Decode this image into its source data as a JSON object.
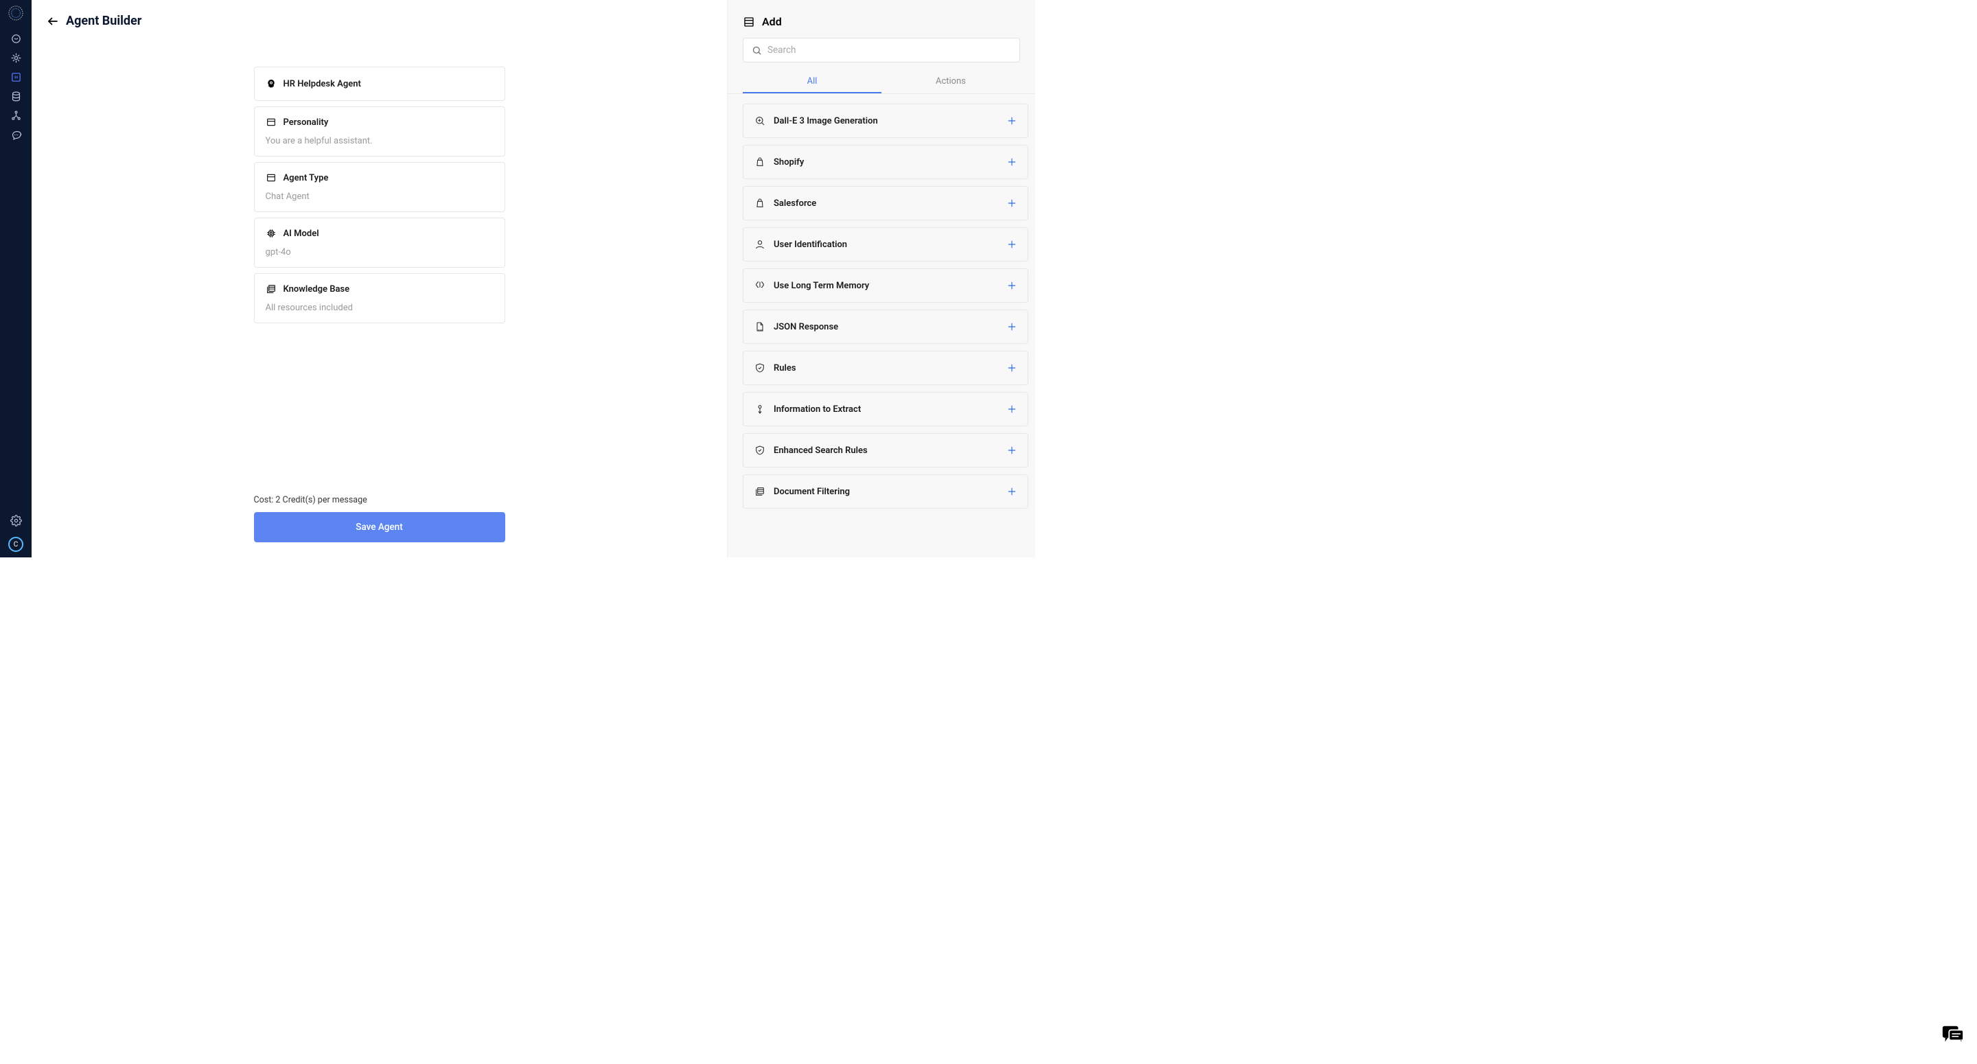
{
  "header": {
    "title": "Agent Builder"
  },
  "cards": {
    "name": {
      "title": "HR Helpdesk Agent"
    },
    "personality": {
      "title": "Personality",
      "sub": "You are a helpful assistant."
    },
    "agentType": {
      "title": "Agent Type",
      "sub": "Chat Agent"
    },
    "aiModel": {
      "title": "AI Model",
      "sub": "gpt-4o"
    },
    "knowledge": {
      "title": "Knowledge Base",
      "sub": "All resources included"
    }
  },
  "footer": {
    "cost": "Cost: 2 Credit(s) per message",
    "saveBtn": "Save Agent"
  },
  "panel": {
    "title": "Add",
    "searchPlaceholder": "Search",
    "tabs": {
      "all": "All",
      "actions": "Actions"
    },
    "items": [
      "Dall-E 3 Image Generation",
      "Shopify",
      "Salesforce",
      "User Identification",
      "Use Long Term Memory",
      "JSON Response",
      "Rules",
      "Information to Extract",
      "Enhanced Search Rules",
      "Document Filtering"
    ]
  },
  "avatar": "C"
}
